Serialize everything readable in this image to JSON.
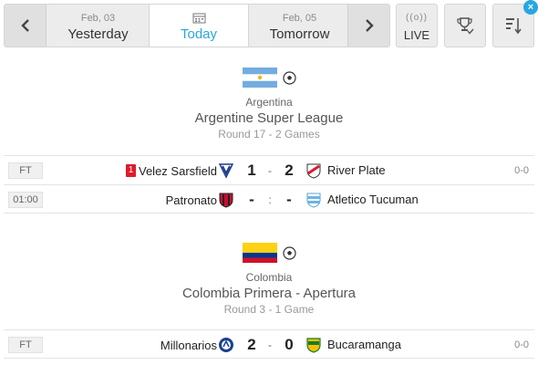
{
  "nav": {
    "yesterday": {
      "date": "Feb, 03",
      "label": "Yesterday"
    },
    "today": {
      "label": "Today",
      "icon": "calendar-icon"
    },
    "tomorrow": {
      "date": "Feb, 05",
      "label": "Tomorrow"
    },
    "live_label": "LIVE",
    "live_icon": "((o))",
    "sort_badge": "×",
    "accent_color": "#29a6e0"
  },
  "leagues": [
    {
      "country": "Argentina",
      "name": "Argentine Super League",
      "round": "Round 17 - 2 Games",
      "matches": [
        {
          "status": "FT",
          "red_cards": "1",
          "home": "Velez Sarsfield",
          "home_score": "1",
          "sep": "-",
          "away_score": "2",
          "away": "River Plate",
          "ht": "0-0"
        },
        {
          "status": "01:00",
          "home": "Patronato",
          "home_score": "-",
          "sep": ":",
          "away_score": "-",
          "away": "Atletico Tucuman",
          "ht": ""
        }
      ]
    },
    {
      "country": "Colombia",
      "name": "Colombia Primera - Apertura",
      "round": "Round 3 - 1 Game",
      "matches": [
        {
          "status": "FT",
          "home": "Millonarios",
          "home_score": "2",
          "sep": "-",
          "away_score": "0",
          "away": "Bucaramanga",
          "ht": "0-0"
        }
      ]
    }
  ]
}
